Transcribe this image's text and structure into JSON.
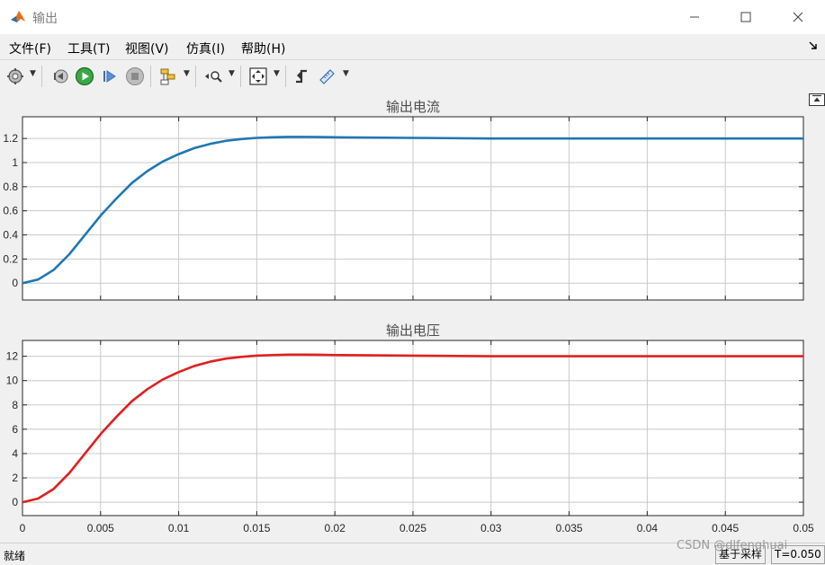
{
  "window": {
    "title": "输出",
    "minimize_label": "—",
    "maximize_label": "☐",
    "close_label": "✕"
  },
  "menu": {
    "file": "文件(F)",
    "tools": "工具(T)",
    "view": "视图(V)",
    "simulation": "仿真(I)",
    "help": "帮助(H)"
  },
  "toolbar": {
    "icons": [
      "gear-icon",
      "step-back-icon",
      "run-icon",
      "step-forward-icon",
      "stop-icon",
      "signal-selector-icon",
      "zoom-icon",
      "fit-to-view-icon",
      "triggers-icon",
      "measurements-icon"
    ]
  },
  "colors": {
    "current_line": "#1f77b4",
    "voltage_line": "#e02020",
    "grid": "#c8c8c8",
    "axes": "#262626"
  },
  "chart_data": [
    {
      "type": "line",
      "title": "输出电流",
      "xlabel": "",
      "ylabel": "",
      "xlim": [
        0,
        0.05
      ],
      "ylim": [
        -0.14,
        1.38
      ],
      "grid": true,
      "xticks": [
        0,
        0.005,
        0.01,
        0.015,
        0.02,
        0.025,
        0.03,
        0.035,
        0.04,
        0.045,
        0.05
      ],
      "yticks": [
        0,
        0.2,
        0.4,
        0.6,
        0.8,
        1,
        1.2
      ],
      "ytick_labels": [
        "0",
        "0.2",
        "0.4",
        "0.6",
        "0.8",
        "1",
        "1.2"
      ],
      "xtick_labels": [],
      "series": [
        {
          "color": "#1f77b4",
          "x": [
            0,
            0.001,
            0.002,
            0.003,
            0.004,
            0.005,
            0.006,
            0.007,
            0.008,
            0.009,
            0.01,
            0.011,
            0.012,
            0.013,
            0.014,
            0.015,
            0.016,
            0.017,
            0.018,
            0.019,
            0.02,
            0.025,
            0.03,
            0.035,
            0.04,
            0.045,
            0.05
          ],
          "y": [
            0,
            0.03,
            0.11,
            0.24,
            0.4,
            0.56,
            0.7,
            0.83,
            0.93,
            1.01,
            1.07,
            1.12,
            1.155,
            1.18,
            1.195,
            1.205,
            1.21,
            1.213,
            1.213,
            1.212,
            1.21,
            1.205,
            1.2,
            1.2,
            1.2,
            1.2,
            1.2
          ]
        }
      ]
    },
    {
      "type": "line",
      "title": "输出电压",
      "xlabel": "",
      "ylabel": "",
      "xlim": [
        0,
        0.05
      ],
      "ylim": [
        -1.1,
        13.3
      ],
      "grid": true,
      "xticks": [
        0,
        0.005,
        0.01,
        0.015,
        0.02,
        0.025,
        0.03,
        0.035,
        0.04,
        0.045,
        0.05
      ],
      "xtick_labels": [
        "0",
        "0.005",
        "0.01",
        "0.015",
        "0.02",
        "0.025",
        "0.03",
        "0.035",
        "0.04",
        "0.045",
        "0.05"
      ],
      "yticks": [
        0,
        2,
        4,
        6,
        8,
        10,
        12
      ],
      "ytick_labels": [
        "0",
        "2",
        "4",
        "6",
        "8",
        "10",
        "12"
      ],
      "series": [
        {
          "color": "#e02020",
          "x": [
            0,
            0.001,
            0.002,
            0.003,
            0.004,
            0.005,
            0.006,
            0.007,
            0.008,
            0.009,
            0.01,
            0.011,
            0.012,
            0.013,
            0.014,
            0.015,
            0.016,
            0.017,
            0.018,
            0.019,
            0.02,
            0.025,
            0.03,
            0.035,
            0.04,
            0.045,
            0.05
          ],
          "y": [
            0,
            0.3,
            1.1,
            2.4,
            4.0,
            5.6,
            7.0,
            8.3,
            9.3,
            10.1,
            10.7,
            11.2,
            11.55,
            11.8,
            11.95,
            12.05,
            12.1,
            12.13,
            12.13,
            12.12,
            12.1,
            12.05,
            12.0,
            12.0,
            12.0,
            12.0,
            12.0
          ]
        }
      ]
    }
  ],
  "status": {
    "ready": "就绪",
    "sample_mode": "基于采样",
    "time": "T=0.050",
    "watermark": "CSDN @dlfenghuai"
  }
}
